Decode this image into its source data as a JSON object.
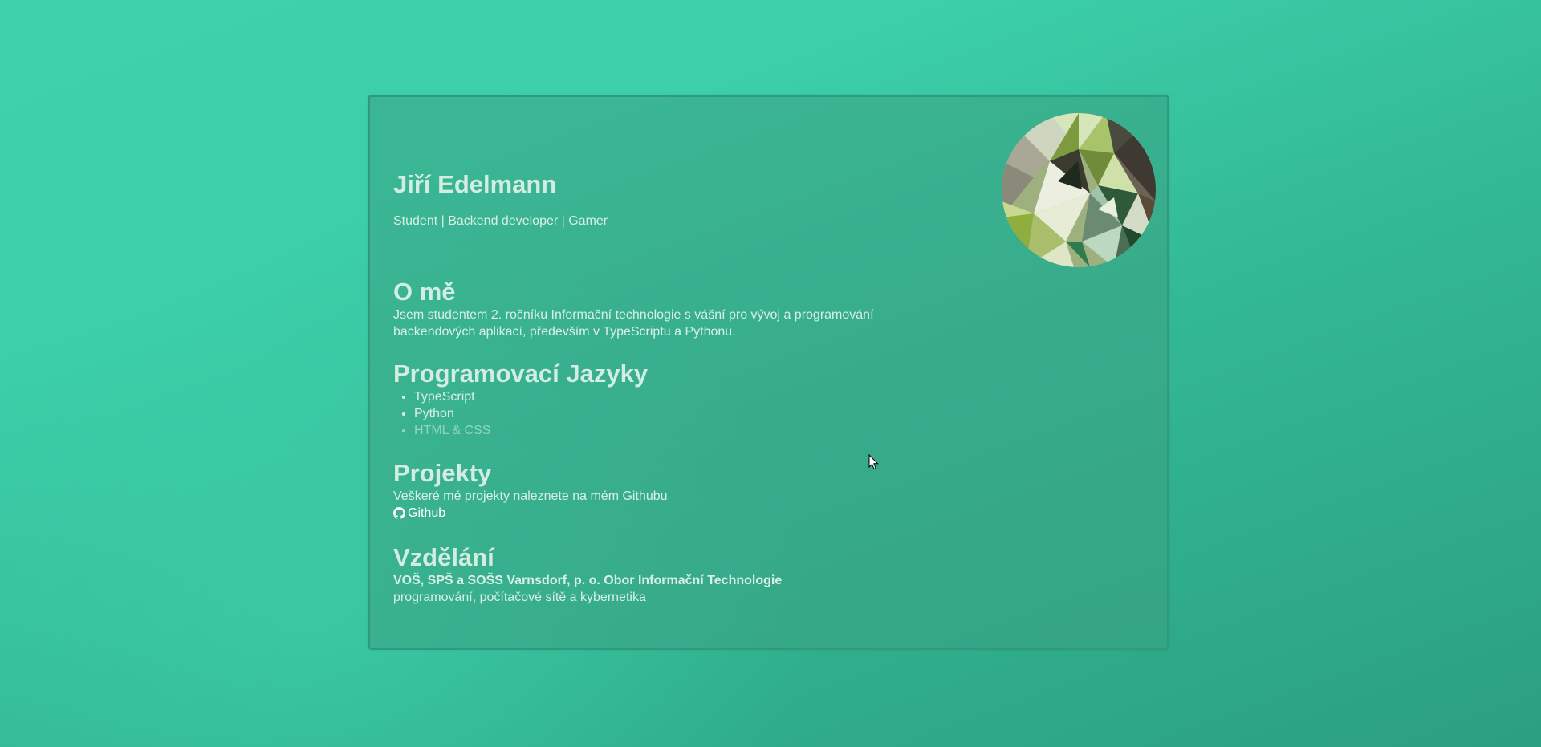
{
  "profile": {
    "name": "Jiří Edelmann",
    "tagline": "Student | Backend developer | Gamer",
    "avatar_icon": "geometric-avatar-image"
  },
  "about": {
    "heading": "O mě",
    "text": "Jsem studentem 2. ročníku Informační technologie s vášní pro vývoj a programování backendových aplikací, především v TypeScriptu a Pythonu."
  },
  "languages": {
    "heading": "Programovací Jazyky",
    "items": [
      "TypeScript",
      "Python",
      "HTML & CSS"
    ]
  },
  "projects": {
    "heading": "Projekty",
    "text": "Veškeré mé projekty naleznete na mém Githubu",
    "link_label": "Github",
    "link_icon": "github-icon"
  },
  "education": {
    "heading": "Vzdělání",
    "school": "VOŠ, SPŠ a SOŠS Varnsdorf, p. o. Obor Informační Technologie",
    "subjects": "programování, počítačové sítě a kybernetika"
  },
  "colors": {
    "background_start": "#3ed1ab",
    "background_end": "#2b9f80",
    "card_border": "#2f9a7d",
    "text": "#d8f0e6"
  }
}
